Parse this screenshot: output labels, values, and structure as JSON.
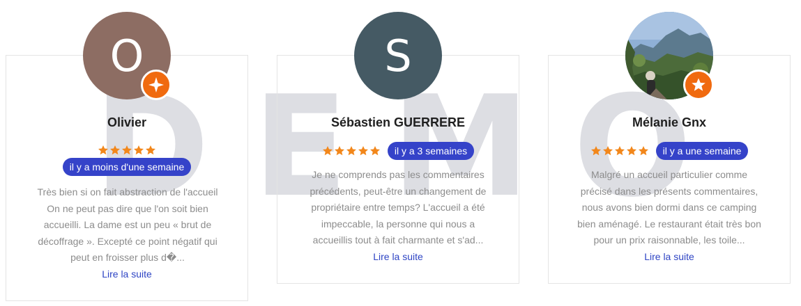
{
  "watermark": "DEMO",
  "colors": {
    "date_pill": "#3543c9",
    "star": "#f2871b",
    "badge": "#f06a0f",
    "link": "#2e44c4"
  },
  "reviews": [
    {
      "avatar_letter": "O",
      "avatar_color": "#8d6d63",
      "name": "Olivier",
      "stars": 5,
      "date": "il y a moins d'une semaine",
      "text": "Très bien si on fait abstraction de l'accueil On ne peut pas dire que l'on soit bien accueilli. La dame est un peu « brut de décoffrage ». Excepté ce point négatif qui peut en froisser plus d�...",
      "read_more": "Lire la suite",
      "badge_icon": "compass-star-icon"
    },
    {
      "avatar_letter": "S",
      "avatar_color": "#455a64",
      "name": "Sébastien GUERRERE",
      "stars": 5,
      "date": "il y a 3 semaines",
      "text": "Je ne comprends pas les commentaires précédents, peut-être un changement de propriétaire entre temps? L'accueil a été impeccable, la personne qui nous a accueillis tout à fait charmante et s'ad...",
      "read_more": "Lire la suite",
      "badge_icon": ""
    },
    {
      "avatar_letter": "",
      "avatar_color": "#6d8fb5",
      "name": "Mélanie Gnx",
      "stars": 5,
      "date": "il y a une semaine",
      "text": "Malgré un accueil particulier comme précisé dans les présents commentaires, nous avons bien dormi dans ce camping bien aménagé. Le restaurant était très bon pour un prix raisonnable, les toile...",
      "read_more": "Lire la suite",
      "badge_icon": "star-icon"
    }
  ]
}
